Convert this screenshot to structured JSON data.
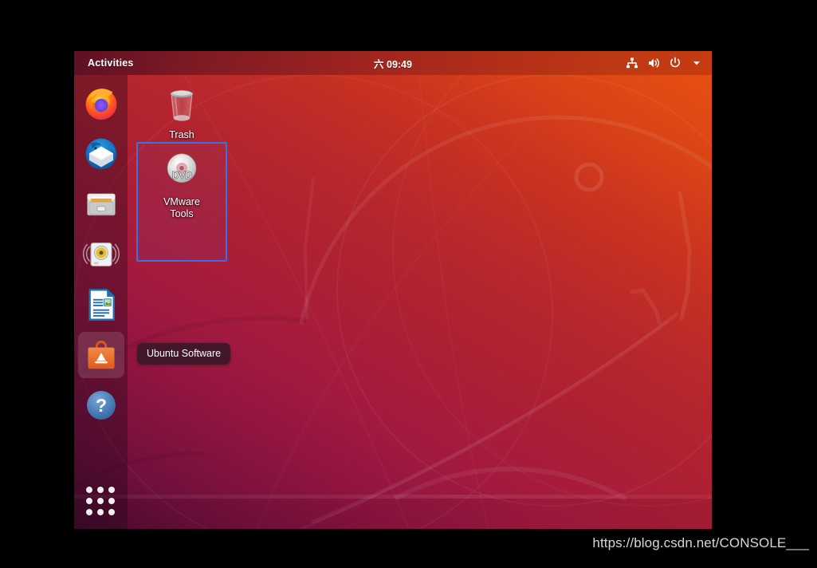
{
  "topbar": {
    "activities_label": "Activities",
    "clock": "六 09:49",
    "tray": [
      {
        "name": "network-icon",
        "label": "Network"
      },
      {
        "name": "volume-icon",
        "label": "Volume"
      },
      {
        "name": "power-icon",
        "label": "Power"
      },
      {
        "name": "chevron-down-icon",
        "label": "System menu"
      }
    ],
    "gradient_from": "#5e1024",
    "gradient_to": "#c43c10"
  },
  "dock": {
    "items": [
      {
        "name": "firefox",
        "label": "Firefox Web Browser",
        "hovered": false
      },
      {
        "name": "thunderbird",
        "label": "Thunderbird Mail",
        "hovered": false
      },
      {
        "name": "files",
        "label": "Files",
        "hovered": false
      },
      {
        "name": "rhythmbox",
        "label": "Rhythmbox",
        "hovered": false
      },
      {
        "name": "libreoffice-writer",
        "label": "LibreOffice Writer",
        "hovered": false
      },
      {
        "name": "ubuntu-software",
        "label": "Ubuntu Software",
        "hovered": true
      },
      {
        "name": "help",
        "label": "Help",
        "hovered": false
      }
    ],
    "show_applications_label": "Show Applications"
  },
  "tooltip": {
    "text": "Ubuntu Software"
  },
  "desktop": {
    "icons": [
      {
        "name": "trash",
        "label": "Trash",
        "selected": false
      },
      {
        "name": "vmware-tools",
        "label": "VMware\nTools",
        "selected": true
      }
    ],
    "selection_color": "#3f6fe3",
    "wallpaper_from": "#4c0a33",
    "wallpaper_to": "#e8530f"
  },
  "watermark": {
    "text": "https://blog.csdn.net/CONSOLE___"
  }
}
